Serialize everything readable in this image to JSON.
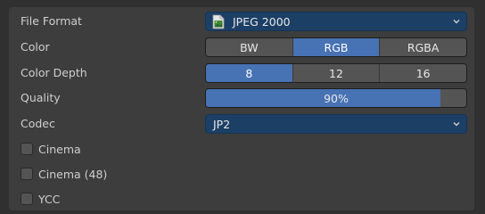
{
  "file_format": {
    "label": "File Format",
    "value": "JPEG 2000",
    "icon": "image-file-icon"
  },
  "color": {
    "label": "Color",
    "options": [
      "BW",
      "RGB",
      "RGBA"
    ],
    "selected": 1
  },
  "color_depth": {
    "label": "Color Depth",
    "options": [
      "8",
      "12",
      "16"
    ],
    "selected": 0
  },
  "quality": {
    "label": "Quality",
    "value_text": "90%",
    "value": 0.9
  },
  "codec": {
    "label": "Codec",
    "value": "JP2"
  },
  "checkboxes": [
    {
      "label": "Cinema",
      "checked": false
    },
    {
      "label": "Cinema (48)",
      "checked": false
    },
    {
      "label": "YCC",
      "checked": false
    }
  ],
  "colors": {
    "accent": "#4772b3",
    "dropdown_blue": "#1c3f66",
    "panel": "#3d3d3d"
  }
}
